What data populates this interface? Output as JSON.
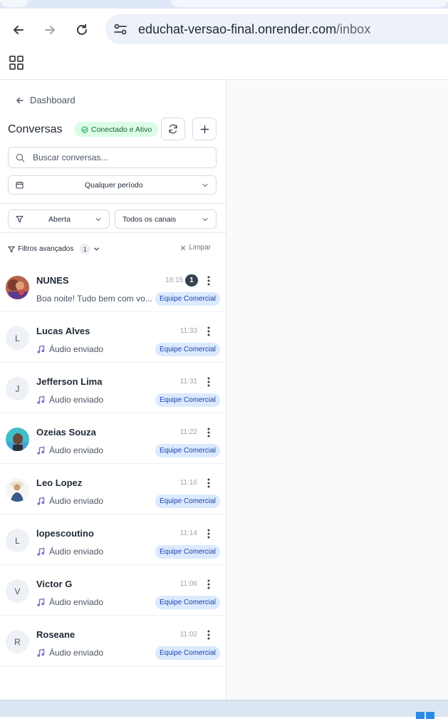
{
  "browser": {
    "url_host": "educhat-versao-final.onrender.com",
    "url_path": "/inbox"
  },
  "sidebar": {
    "back_label": "Dashboard",
    "title": "Conversas",
    "status_label": "Conectado e Ativo",
    "search_placeholder": "Buscar conversas...",
    "period_value": "Qualquer período",
    "status_filter_value": "Aberta",
    "channel_filter_value": "Todos os canais",
    "advanced_filters_label": "Filtros avançados",
    "advanced_filters_count": "1",
    "clear_label": "Limpar"
  },
  "conversations": [
    {
      "name": "NUNES",
      "time": "18:15",
      "unread": "1",
      "preview": "Boa noite! Tudo bem com vo...",
      "team": "Equipe Comercial",
      "initial": ""
    },
    {
      "name": "Lucas Alves",
      "time": "11:33",
      "preview": "Áudio enviado",
      "team": "Equipe Comercial",
      "initial": "L"
    },
    {
      "name": "Jefferson Lima",
      "time": "11:31",
      "preview": "Áudio enviado",
      "team": "Equipe Comercial",
      "initial": "J"
    },
    {
      "name": "Ozeias Souza",
      "time": "11:22",
      "preview": "Áudio enviado",
      "team": "Equipe Comercial",
      "initial": ""
    },
    {
      "name": "Leo Lopez",
      "time": "11:16",
      "preview": "Áudio enviado",
      "team": "Equipe Comercial",
      "initial": ""
    },
    {
      "name": "lopescoutino",
      "time": "11:14",
      "preview": "Áudio enviado",
      "team": "Equipe Comercial",
      "initial": "L"
    },
    {
      "name": "Victor G",
      "time": "11:06",
      "preview": "Áudio enviado",
      "team": "Equipe Comercial",
      "initial": "V"
    },
    {
      "name": "Roseane",
      "time": "11:02",
      "preview": "Áudio enviado",
      "team": "Equipe Comercial",
      "initial": "R"
    }
  ],
  "colors": {
    "status_bg": "#dcfce7",
    "status_text": "#166534",
    "team_tag_bg": "#dbeafe",
    "team_tag_text": "#1e40af",
    "audio_icon": "#7c6fd0"
  }
}
